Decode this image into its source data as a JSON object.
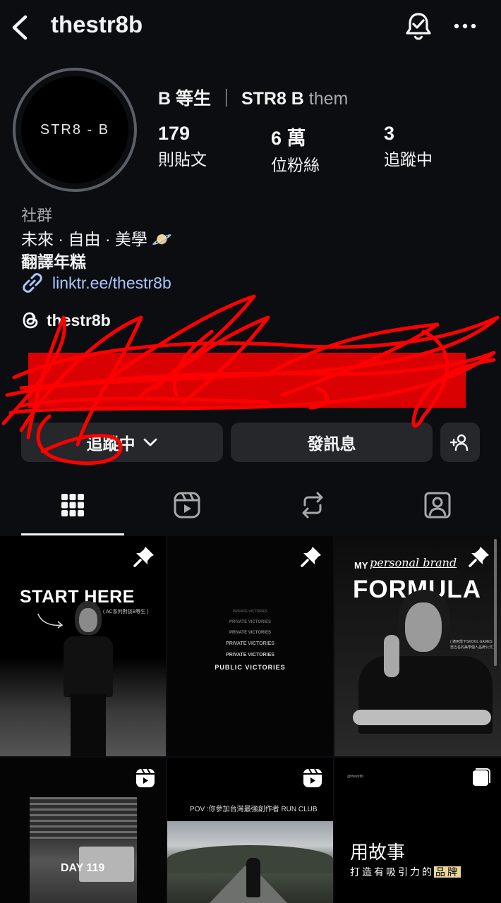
{
  "header": {
    "username": "thestr8b"
  },
  "profile": {
    "avatar_text": "STR8 - B",
    "display_name": "B 等生",
    "name_separator": "｜",
    "name_suffix_bold": "STR8 B",
    "name_suffix_light": "them",
    "stats": [
      {
        "value": "179",
        "label": "則貼文"
      },
      {
        "value": "6 萬",
        "label": "位粉絲"
      },
      {
        "value": "3",
        "label": "追蹤中"
      }
    ],
    "category": "社群",
    "bio_line1": "未來 · 自由 · 美學 🪐",
    "bio_line2": "翻譯年糕",
    "link": "linktr.ee/thestr8b",
    "threads_handle": "thestr8b"
  },
  "actions": {
    "following_label": "追蹤中",
    "message_label": "發訊息"
  },
  "colors": {
    "link": "#a9c7ff",
    "background": "#0b0d11",
    "button": "#26272b",
    "scribble": "#ff0000"
  },
  "posts": [
    {
      "title": "START HERE",
      "caption": "( AC系列對談B等生 )",
      "pinned": true
    },
    {
      "lines": [
        "PRIVATE VICTORIES",
        "PRIVATE VICTORIES",
        "PRIVATE VICTORIES",
        "PRIVATE VICTORIES",
        "PRIVATE VICTORIES",
        "PUBLIC VICTORIES"
      ],
      "pinned": true
    },
    {
      "title_small": "MY",
      "title_script": "personal brand",
      "title": "FORMULA",
      "caption_line1": "( 適用當下SKOOL GAMES",
      "caption_line2": "當五名的美學個人品牌公式 )",
      "pinned": true
    },
    {
      "title": "DAY 119",
      "reel": true
    },
    {
      "title": "POV :你參加台灣最強創作者 RUN CLUB",
      "reel": true
    },
    {
      "handle": "@thestr8b",
      "title": "用故事",
      "subtitle": "打造有吸引力的",
      "subtitle_highlight": "品牌",
      "carousel": true
    }
  ]
}
